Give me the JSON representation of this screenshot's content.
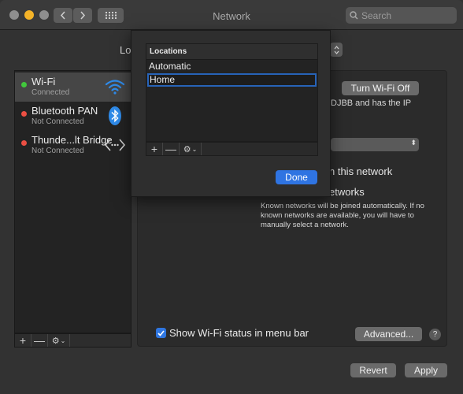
{
  "window": {
    "title": "Network"
  },
  "search": {
    "placeholder": "Search"
  },
  "location": {
    "label_partial": "Lo"
  },
  "services": [
    {
      "name": "Wi-Fi",
      "status": "Connected",
      "status_color": "#41c83c",
      "icon": "wifi-icon",
      "selected": true
    },
    {
      "name": "Bluetooth PAN",
      "status": "Not Connected",
      "status_color": "#ec4f43",
      "icon": "bluetooth-icon",
      "selected": false
    },
    {
      "name": "Thunde...lt Bridge",
      "status": "Not Connected",
      "status_color": "#ec4f43",
      "icon": "thunderbolt-bridge-icon",
      "selected": false
    }
  ],
  "sidebar_bar": {
    "add": "+",
    "remove": "—"
  },
  "main": {
    "turn_off": "Turn Wi-Fi Off",
    "ip_partial_1": "DJBB and has the IP",
    "ask_partial": "n this network",
    "networks_partial": "etworks",
    "ask_note": "Known networks will be joined automatically. If no known networks are available, you will have to manually select a network.",
    "show_status": "Show Wi-Fi status in menu bar",
    "advanced": "Advanced...",
    "help": "?",
    "revert": "Revert",
    "apply": "Apply"
  },
  "sheet": {
    "header": "Locations",
    "rows": [
      "Automatic",
      "Home"
    ],
    "editing_row": "Home",
    "add": "+",
    "remove": "—",
    "done": "Done"
  },
  "colors": {
    "accent": "#2f74e2",
    "window_bg": "#323232"
  }
}
